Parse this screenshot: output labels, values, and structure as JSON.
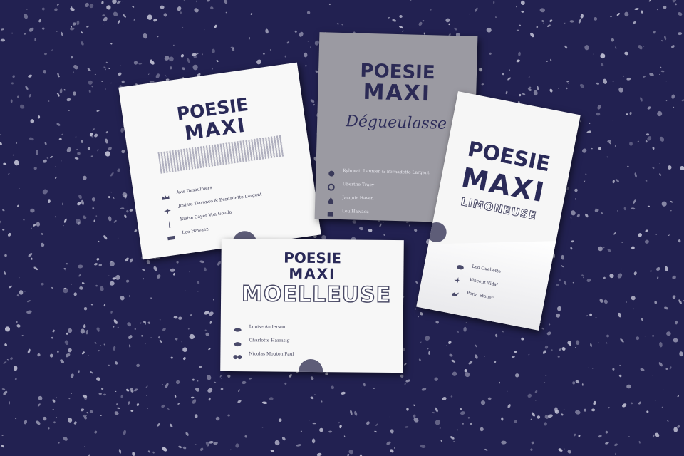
{
  "image": {
    "background_color": "#222151",
    "speckle_color": "#bfbfd2"
  },
  "cards": [
    {
      "id": "card-white-noisy",
      "title_line1": "POESIE",
      "title_line2": "MAXI",
      "background": "#f8f8f8",
      "names": [
        "Avis Desaulniers",
        "Joshua Tiaronco & Bernadette Largent",
        "Blaise Cayer Von Gouda",
        "Leo Hawaez"
      ]
    },
    {
      "id": "card-grey-script",
      "title_line1": "POESIE",
      "title_line2": "MAXI",
      "subtitle": "Dégueulasse",
      "background": "#9b9aa2",
      "names": [
        "Kylowatt Lannier & Bernadette Largent",
        "Uberthe Tracy",
        "Jacquie Haven",
        "Lou Hawaez"
      ]
    },
    {
      "id": "card-tall-limoneuse",
      "title_line1": "POESIE",
      "title_line2": "MAXI",
      "subtitle": "LIMONEUSE",
      "background": "#f6f6f6",
      "names": [
        "Leo Ouellette",
        "Vincent Vidal",
        "Perla Stoner"
      ]
    },
    {
      "id": "card-moelleuse",
      "title_line1": "POESIE",
      "title_line2": "MAXI",
      "subtitle": "MOELLEUSE",
      "background": "#f7f7f7",
      "names": [
        "Louise Anderson",
        "Charlotte Harmsig",
        "Nicolas Mouton Paul"
      ]
    }
  ]
}
